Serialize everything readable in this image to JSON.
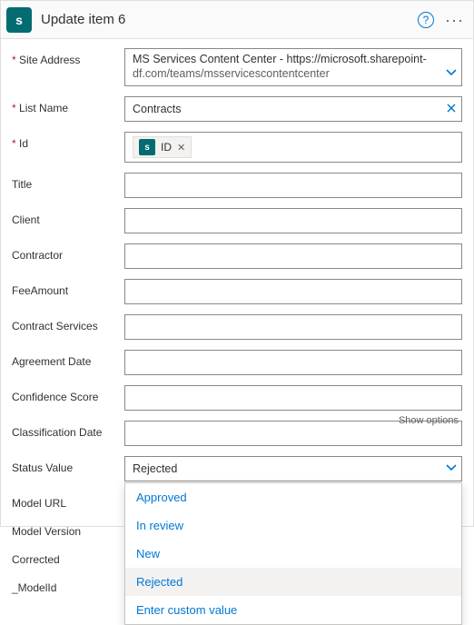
{
  "header": {
    "title": "Update item 6",
    "app_icon_letter": "s"
  },
  "labels": {
    "site_address": "Site Address",
    "list_name": "List Name",
    "id": "Id",
    "title": "Title",
    "client": "Client",
    "contractor": "Contractor",
    "fee_amount": "FeeAmount",
    "contract_services": "Contract Services",
    "agreement_date": "Agreement Date",
    "confidence_score": "Confidence Score",
    "classification_date": "Classification Date",
    "status_value": "Status Value",
    "model_url": "Model URL",
    "model_version": "Model Version",
    "corrected": "Corrected",
    "model_id": "_ModelId"
  },
  "values": {
    "site_address_line1": "MS Services Content Center - https://microsoft.sharepoint-",
    "site_address_line2": "df.com/teams/msservicescontentcenter",
    "list_name": "Contracts",
    "id_pill": "ID",
    "status_value": "Rejected"
  },
  "hints": {
    "show_options": "Show options"
  },
  "status_options": [
    {
      "label": "Approved",
      "selected": false
    },
    {
      "label": "In review",
      "selected": false
    },
    {
      "label": "New",
      "selected": false
    },
    {
      "label": "Rejected",
      "selected": true
    },
    {
      "label": "Enter custom value",
      "selected": false
    }
  ]
}
